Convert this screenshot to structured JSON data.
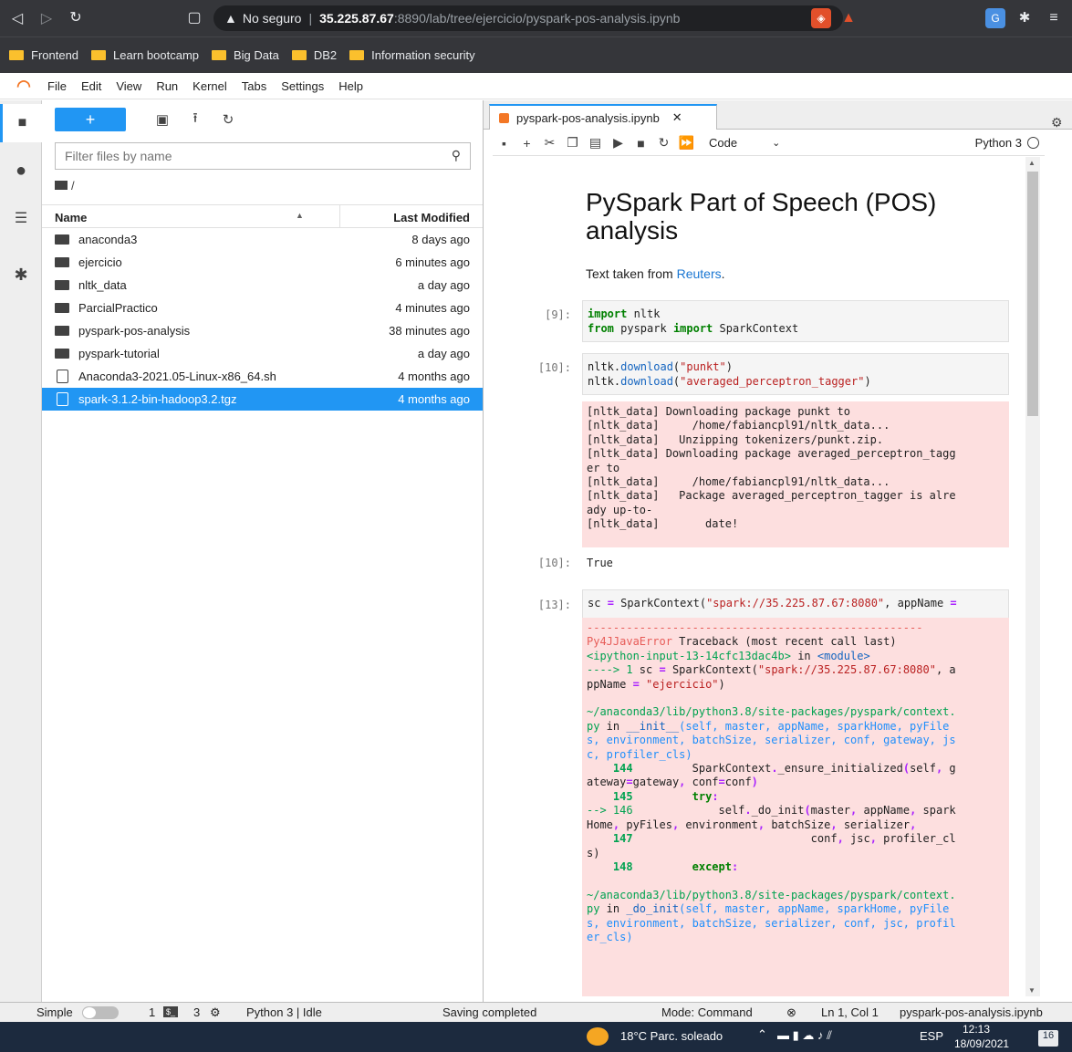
{
  "browser": {
    "url_warning": "No seguro",
    "url_host": "35.225.87.67",
    "url_rest": ":8890/lab/tree/ejercicio/pyspark-pos-analysis.ipynb",
    "bookmarks": [
      "Frontend",
      "Learn bootcamp",
      "Big Data",
      "DB2",
      "Information security"
    ]
  },
  "menubar": {
    "items": [
      "File",
      "Edit",
      "View",
      "Run",
      "Kernel",
      "Tabs",
      "Settings",
      "Help"
    ]
  },
  "filebrowser": {
    "filter_placeholder": "Filter files by name",
    "breadcrumb": "/",
    "col_name": "Name",
    "col_modified": "Last Modified",
    "files": [
      {
        "name": "anaconda3",
        "modified": "8 days ago",
        "type": "dir"
      },
      {
        "name": "ejercicio",
        "modified": "6 minutes ago",
        "type": "dir"
      },
      {
        "name": "nltk_data",
        "modified": "a day ago",
        "type": "dir"
      },
      {
        "name": "ParcialPractico",
        "modified": "4 minutes ago",
        "type": "dir"
      },
      {
        "name": "pyspark-pos-analysis",
        "modified": "38 minutes ago",
        "type": "dir"
      },
      {
        "name": "pyspark-tutorial",
        "modified": "a day ago",
        "type": "dir"
      },
      {
        "name": "Anaconda3-2021.05-Linux-x86_64.sh",
        "modified": "4 months ago",
        "type": "file"
      },
      {
        "name": "spark-3.1.2-bin-hadoop3.2.tgz",
        "modified": "4 months ago",
        "type": "file",
        "selected": true
      }
    ]
  },
  "notebook": {
    "tab_title": "pyspark-pos-analysis.ipynb",
    "cell_type": "Code",
    "kernel_name": "Python 3",
    "title": "PySpark Part of Speech (POS) analysis",
    "text_prefix": "Text taken from ",
    "text_link": "Reuters",
    "text_suffix": ".",
    "prompt_9": "[9]:",
    "prompt_10": "[10]:",
    "prompt_10_out": "[10]:",
    "out_10": "True",
    "prompt_13": "[13]:"
  },
  "statusbar": {
    "mode": "Simple",
    "count1": "1",
    "count2": "3",
    "kernel_status": "Python 3 | Idle",
    "saving": "Saving completed",
    "command_mode": "Mode: Command",
    "position": "Ln 1, Col 1",
    "file": "pyspark-pos-analysis.ipynb"
  },
  "taskbar": {
    "weather": "18°C Parc. soleado",
    "lang": "ESP",
    "time": "12:13",
    "date": "18/09/2021",
    "notifications": "16"
  },
  "colors": {
    "accent": "#2196f3",
    "stderr_bg": "#fddfdf",
    "jupyter_orange": "#f37726"
  }
}
